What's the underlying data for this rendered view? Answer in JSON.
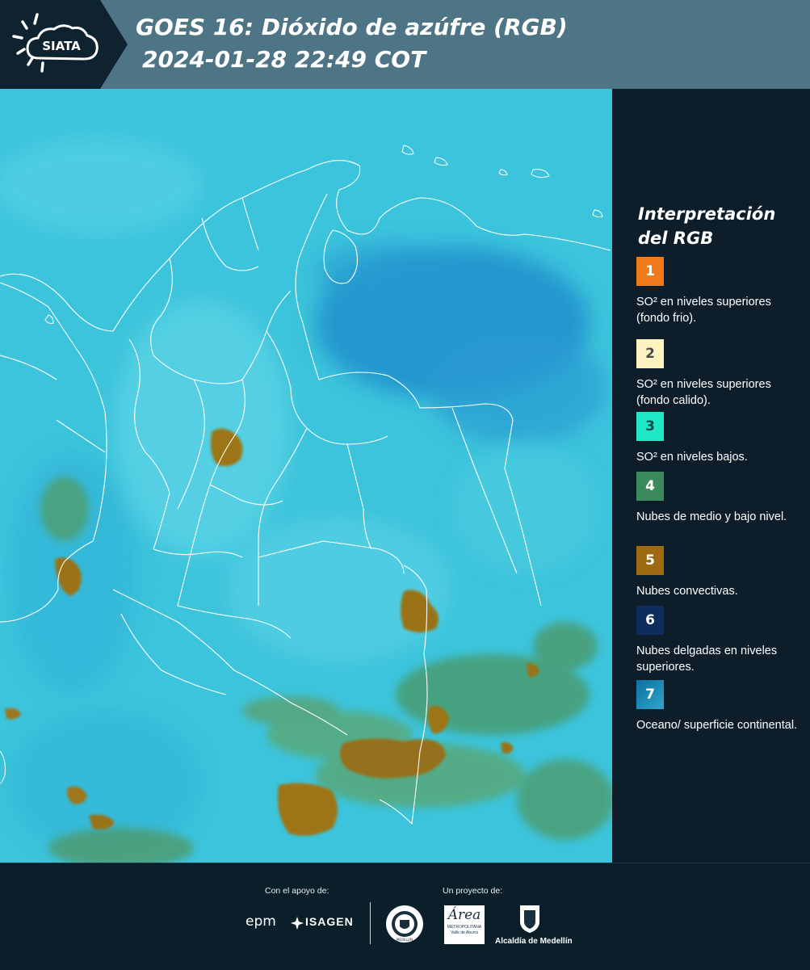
{
  "header": {
    "logo_text": "SIATA",
    "title_line1": "GOES 16: Dióxido de azúfre (RGB)",
    "title_line2": "2024-01-28 22:49 COT"
  },
  "legend": {
    "title": "Interpretación del RGB",
    "items": [
      {
        "number": "1",
        "label": "SO² en niveles superiores (fondo frio).",
        "color": "#f07a1a"
      },
      {
        "number": "2",
        "label": "SO² en niveles superiores (fondo calido).",
        "color": "#fcf4c0"
      },
      {
        "number": "3",
        "label": "SO² en niveles bajos.",
        "color": "#1ee8c6"
      },
      {
        "number": "4",
        "label": "Nubes de medio y bajo nivel.",
        "color": "#3a8a5c"
      },
      {
        "number": "5",
        "label": "Nubes convectivas.",
        "color": "#9c6a10"
      },
      {
        "number": "6",
        "label": "Nubes delgadas en niveles superiores.",
        "color": "#0e2d5c"
      },
      {
        "number": "7",
        "label": "Oceano/ superficie continental.",
        "color": "#1b8ab4"
      }
    ]
  },
  "footer": {
    "support_caption": "Con el apoyo de:",
    "project_caption": "Un proyecto de:",
    "sponsor_epm": "epm",
    "sponsor_isagen": "ISAGEN",
    "org_area_title": "Área",
    "org_area_sub1": "METROPOLITANA",
    "org_area_sub2": "Valle de Aburrá",
    "org_alcaldia": "Alcaldía de Medellín",
    "org_medellin_seal": "MEDELLÍN"
  },
  "colors": {
    "header_bg": "#4d7585",
    "logo_bg": "#0e2230",
    "map_base": "#3cc4dc",
    "legend_bg": "#0d1e2a"
  }
}
